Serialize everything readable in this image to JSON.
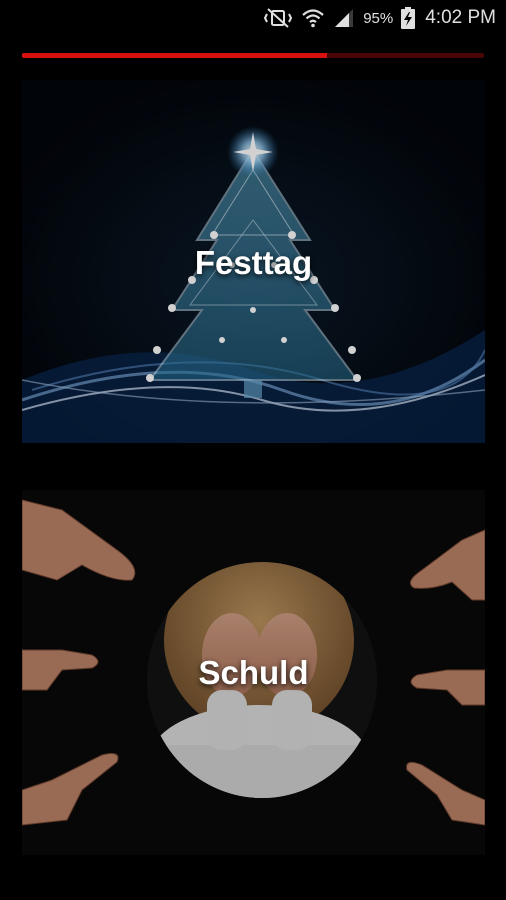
{
  "status_bar": {
    "icons": [
      "vibrate-mute-icon",
      "wifi-icon",
      "signal-icon",
      "battery-charging-icon"
    ],
    "battery": "95%",
    "time": "4:02 PM"
  },
  "progress": {
    "value": 0.66,
    "fill_color": "#d81010",
    "track_color": "#4a0606"
  },
  "cards": [
    {
      "label": "Festtag"
    },
    {
      "label": "Schuld"
    }
  ]
}
